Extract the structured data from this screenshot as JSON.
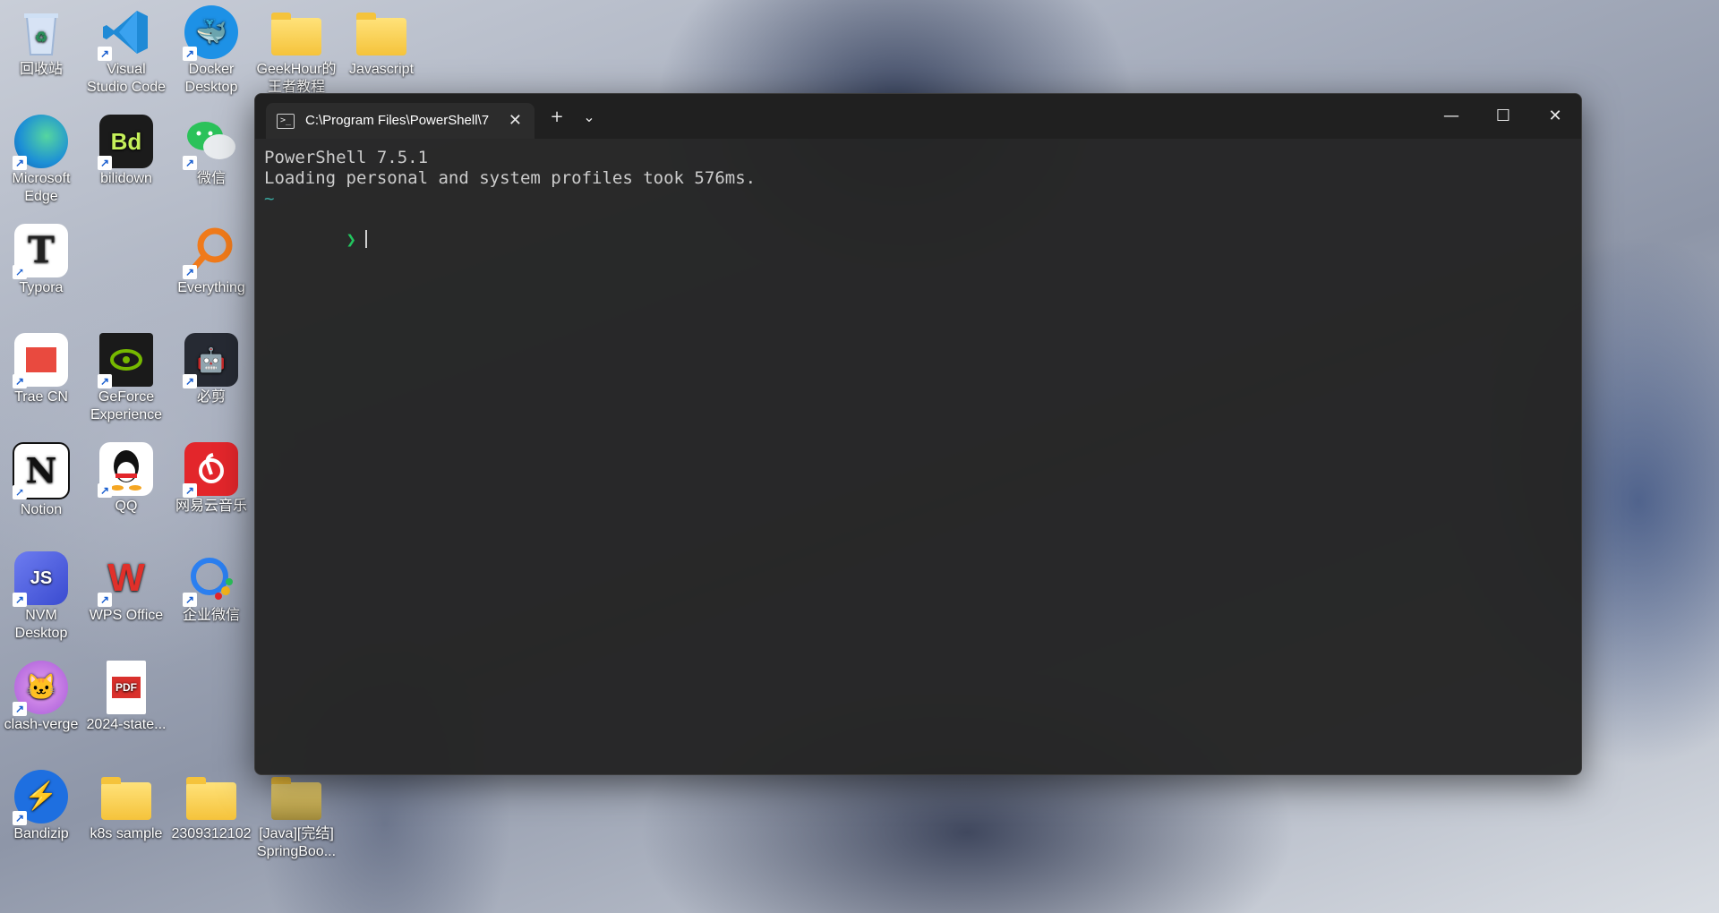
{
  "desktop": {
    "icons": [
      {
        "label": "回收站",
        "icon": "recycle-bin-icon"
      },
      {
        "label": "Visual Studio Code",
        "icon": "vscode-icon"
      },
      {
        "label": "Docker Desktop",
        "icon": "docker-icon"
      },
      {
        "label": "GeekHour的王者教程",
        "icon": "folder-icon"
      },
      {
        "label": "Javascript",
        "icon": "folder-icon"
      },
      {
        "label": "Microsoft Edge",
        "icon": "edge-icon"
      },
      {
        "label": "bilidown",
        "icon": "bilidown-icon",
        "glyph": "Bd"
      },
      {
        "label": "微信",
        "icon": "wechat-icon"
      },
      {
        "label": "Typora",
        "icon": "typora-icon",
        "glyph": "T"
      },
      {
        "label": "Everything",
        "icon": "everything-icon"
      },
      {
        "label": "Trae CN",
        "icon": "trae-icon"
      },
      {
        "label": "GeForce Experience",
        "icon": "geforce-icon"
      },
      {
        "label": "必剪",
        "icon": "bijian-icon"
      },
      {
        "label": "Notion",
        "icon": "notion-icon",
        "glyph": "N"
      },
      {
        "label": "QQ",
        "icon": "qq-icon"
      },
      {
        "label": "网易云音乐",
        "icon": "netease-music-icon"
      },
      {
        "label": "NVM Desktop",
        "icon": "nvm-icon",
        "glyph": "JS"
      },
      {
        "label": "WPS Office",
        "icon": "wps-icon",
        "glyph": "W"
      },
      {
        "label": "企业微信",
        "icon": "wecom-icon"
      },
      {
        "label": "clash-verge",
        "icon": "clash-verge-icon"
      },
      {
        "label": "2024-state...",
        "icon": "pdf-icon",
        "glyph": "PDF"
      },
      {
        "label": "Bandizip",
        "icon": "bandizip-icon"
      },
      {
        "label": "k8s sample",
        "icon": "folder-icon"
      },
      {
        "label": "2309312102",
        "icon": "folder-icon"
      },
      {
        "label": "[Java][完结] SpringBoo...",
        "icon": "folder-icon"
      }
    ]
  },
  "terminal": {
    "tab_title": "C:\\Program Files\\PowerShell\\7",
    "tab_icon": "powershell-icon",
    "new_tab_glyph": "+",
    "dropdown_glyph": "⌄",
    "window_buttons": {
      "minimize": "—",
      "maximize": "☐",
      "close": "✕"
    },
    "lines": {
      "version": "PowerShell 7.5.1",
      "profile": "Loading personal and system profiles took 576ms.",
      "cwd": "~",
      "prompt": "❯"
    }
  },
  "colors": {
    "terminal_bg": "#242424",
    "titlebar_bg": "#202020",
    "prompt_green": "#22c55e",
    "tilde_teal": "#3aa8a0"
  }
}
